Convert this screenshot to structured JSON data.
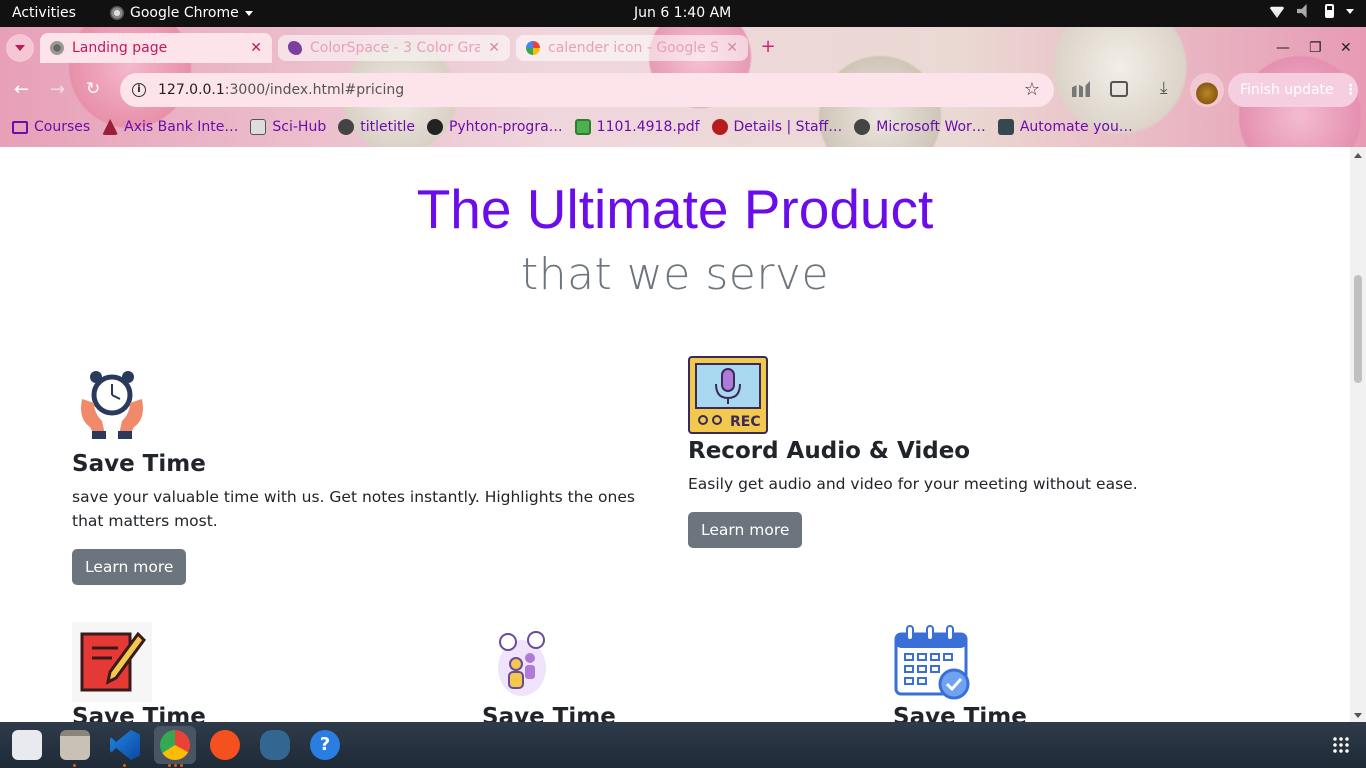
{
  "system": {
    "activities": "Activities",
    "app_name": "Google Chrome",
    "clock": "Jun 6   1:40 AM"
  },
  "browser": {
    "tabs": [
      {
        "title": "Landing page",
        "active": true
      },
      {
        "title": "ColorSpace - 3 Color Gra",
        "active": false
      },
      {
        "title": "calender icon - Google S",
        "active": false
      }
    ],
    "url_host": "127.0.0.1",
    "url_rest": ":3000/index.html#pricing",
    "finish_update": "Finish update",
    "bookmarks": [
      {
        "label": "Courses",
        "icon": "folder-icon"
      },
      {
        "label": "Axis Bank Inte…",
        "icon": "axis-bank-icon"
      },
      {
        "label": "Sci-Hub",
        "icon": "scihub-icon"
      },
      {
        "label": "titletitle",
        "icon": "globe-icon"
      },
      {
        "label": "Pyhton-progra…",
        "icon": "github-icon"
      },
      {
        "label": "1101.4918.pdf",
        "icon": "pdf-icon"
      },
      {
        "label": "Details | Staff…",
        "icon": "staff-icon"
      },
      {
        "label": "Microsoft Wor…",
        "icon": "globe-icon"
      },
      {
        "label": "Automate you…",
        "icon": "tds-icon"
      }
    ]
  },
  "page": {
    "title": "The Ultimate Product",
    "subtitle": "that we serve",
    "features": [
      {
        "heading": "Save Time",
        "text": "save your valuable time with us. Get notes instantly. Highlights the ones that matters most.",
        "button": "Learn more",
        "icon": "alarm-clock-hands-icon"
      },
      {
        "heading": "Record Audio & Video",
        "text": "Easily get audio and video for your meeting without ease.",
        "button": "Learn more",
        "icon": "microphone-rec-icon",
        "icon_text": "REC"
      }
    ],
    "features_row2": [
      {
        "heading": "Save Time",
        "icon": "notebook-pencil-icon"
      },
      {
        "heading": "Save Time",
        "icon": "chat-people-icon"
      },
      {
        "heading": "Save Time",
        "icon": "calendar-check-icon"
      }
    ]
  },
  "colors": {
    "title_purple": "#6a0dea",
    "subtitle_gray": "#6c757d",
    "button_gray": "#6c757d"
  }
}
